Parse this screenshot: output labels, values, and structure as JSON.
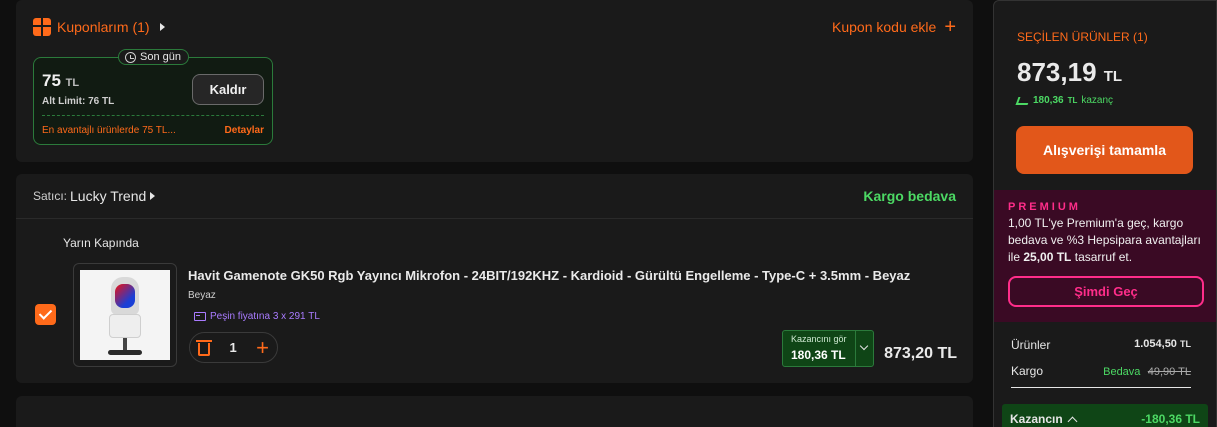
{
  "coupons": {
    "title": "Kuponlarım (1)",
    "add_label": "Kupon kodu ekle",
    "card": {
      "badge": "Son gün",
      "amount": "75",
      "amount_unit": "TL",
      "limit": "Alt Limit: 76 TL",
      "remove_label": "Kaldır",
      "footer": "En avantajlı ürünlerde 75 TL...",
      "details_label": "Detaylar"
    }
  },
  "seller": {
    "prefix": "Satıcı:",
    "name": "Lucky Trend",
    "shipping": "Kargo bedava",
    "delivery": "Yarın Kapında"
  },
  "product": {
    "title": "Havit Gamenote GK50 Rgb Yayıncı Mikrofon - 24BIT/192KHZ - Kardioid - Gürültü Engelleme - Type-C + 3.5mm - Beyaz",
    "color": "Beyaz",
    "installment": "Peşin fiyatına 3 x 291 TL",
    "quantity": "1",
    "savings_label": "Kazancını gör",
    "savings_value": "180,36 TL",
    "price": "873,20 TL",
    "checked": true
  },
  "summary": {
    "selected_title": "SEÇİLEN ÜRÜNLER (1)",
    "total": "873,19",
    "total_unit": "TL",
    "gain_amount": "180,36",
    "gain_unit": "TL",
    "gain_word": "kazanç",
    "checkout_label": "Alışverişi tamamla",
    "premium": {
      "word": "PREMIUM",
      "text_1": "1,00 TL'ye Premium'a geç, kargo bedava ve %3 Hepsipara avantajları ile",
      "text_bold": "25,00 TL",
      "text_2": "tasarruf et.",
      "button": "Şimdi Geç"
    },
    "rows": {
      "products_label": "Ürünler",
      "products_value": "1.054,50",
      "products_unit": "TL",
      "shipping_label": "Kargo",
      "shipping_free": "Bedava",
      "shipping_old": "49,90 TL"
    },
    "gain_label": "Kazancın",
    "gain_value": "-180,36 TL"
  },
  "colors": {
    "accent": "#ff6a1a",
    "success": "#4cd964",
    "premium": "#ff2d8a"
  }
}
